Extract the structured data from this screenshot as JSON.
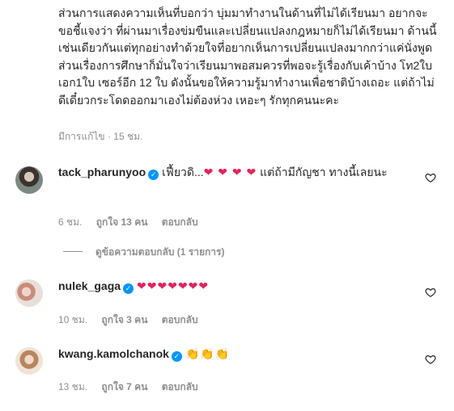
{
  "caption": {
    "text": "ส่วนการแสดงความเห็นที่บอกว่า บุ่มมาทำงานในด้านที่ไม่ได้เรียนมา อยากจะขอชี้แจงว่า ที่ผ่านมาเรื่องข่มขืนและเปลี่ยนแปลงกฎหมายก็ไม่ได้เรียนมา ด้านนี้เช่นเดียวกันแต่ทุกอย่างทำด้วยใจที่อยากเห็นการเปลี่ยนแปลงมากกว่าแค่นั่งพูด ส่วนเรื่องการศึกษาก็มั่นใจว่าเรียนมาพอสมควรที่พอจะรู้เรื่องกับเค้าบ้าง โท2ใบ เอก1ใบ เซอร์อีก 12 ใบ ดังนั้นขอให้ความรู้มาทำงานเพื่อชาติบ้างเถอะ แต่ถ้าไม่ดีเดี๋ยวกระโดดออกมาเองไม่ต้องห่วง เหอะๆ รักทุกคนนะคะ",
    "edited": "มีการแก้ไข",
    "time": "15 ชม."
  },
  "comments": [
    {
      "username": "tack_pharunyoo",
      "verified_icon": "verified-badge-icon",
      "text_before": "เฟี้ยวดิ...",
      "emoji": "❤ ❤ ❤ ❤",
      "text_after": " แต่ถ้ามีกัญชา ทางนี้เลยนะ",
      "time": "6 ชม.",
      "likes": "ถูกใจ 13 คน",
      "reply": "ตอบกลับ"
    },
    {
      "username": "nulek_gaga",
      "verified_icon": "verified-badge-icon",
      "text_before": "",
      "emoji": "❤❤❤❤❤❤❤",
      "text_after": "",
      "time": "10 ชม.",
      "likes": "ถูกใจ 3 คน",
      "reply": "ตอบกลับ"
    },
    {
      "username": "kwang.kamolchanok",
      "verified_icon": "verified-badge-icon",
      "text_before": "",
      "emoji": "👏👏👏",
      "text_after": "",
      "time": "13 ชม.",
      "likes": "ถูกใจ 7 คน",
      "reply": "ตอบกลับ"
    }
  ],
  "view_replies": "ดูข้อความตอบกลับ (1 รายการ)",
  "colors": {
    "text": "#262626",
    "meta": "#8e8e8e",
    "verified": "#0095f6",
    "heart": "#e0245e"
  }
}
